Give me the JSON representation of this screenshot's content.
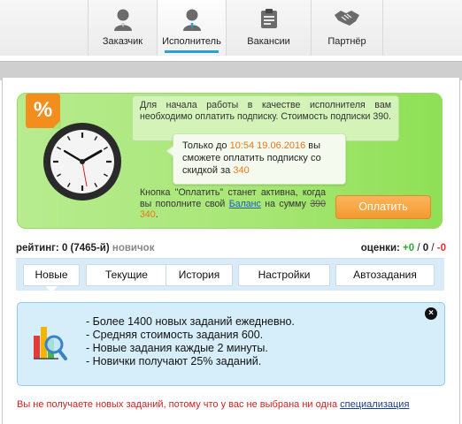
{
  "nav": {
    "tabs": [
      {
        "label": "Заказчик",
        "icon": "customer-user-icon"
      },
      {
        "label": "Исполнитель",
        "icon": "performer-user-icon"
      },
      {
        "label": "Вакансии",
        "icon": "vacancies-clipboard-icon"
      },
      {
        "label": "Партнёр",
        "icon": "partner-handshake-icon"
      }
    ],
    "active_index": 1
  },
  "promo": {
    "percent_badge": "%",
    "intro": "Для начала работы в качестве исполнителя вам необходимо оплатить подписку. Стоимость подписки 390.",
    "offer_prefix": "Только до ",
    "offer_deadline": "10:54 19.06.2016",
    "offer_middle": " вы сможете оплатить подписку со скидкой за ",
    "offer_price": "340",
    "pay_note_prefix": "Кнопка \"Оплатить\" станет активна, когда вы пополните свой ",
    "balance_link": "Баланс",
    "pay_note_middle": " на сумму ",
    "old_price": "390",
    "new_price": "340",
    "pay_note_suffix": ".",
    "pay_button": "Оплатить",
    "clock_time": "10:54"
  },
  "rating": {
    "label": "рейтинг: 0 (7465-й)",
    "status": "новичок"
  },
  "scores": {
    "label": "оценки:",
    "positive": "+0",
    "neutral": "0",
    "negative": "-0",
    "separator": " / "
  },
  "subtabs": [
    {
      "label": "Новые",
      "active": true
    },
    {
      "label": "Текущие",
      "active": false
    },
    {
      "label": "История",
      "active": false
    },
    {
      "label": "Настройки",
      "active": false
    },
    {
      "label": "Автозадания",
      "active": false
    }
  ],
  "info": {
    "items": [
      "- Более 1400 новых заданий ежедневно.",
      "- Средняя стоимость задания 600.",
      "- Новые задания каждые 2 минуты.",
      "- Новички получают 25% заданий."
    ],
    "close_label": "×",
    "icon": "bar-chart-magnifier-icon"
  },
  "warning": {
    "text": "Вы не получаете новых заданий, потому что у вас не выбрана ни одна ",
    "link": "специализация"
  },
  "colors": {
    "accent_blue": "#2b9fd9",
    "promo_green": "#a8e676",
    "pay_orange": "#f19a2f",
    "warning_red": "#d12020"
  }
}
